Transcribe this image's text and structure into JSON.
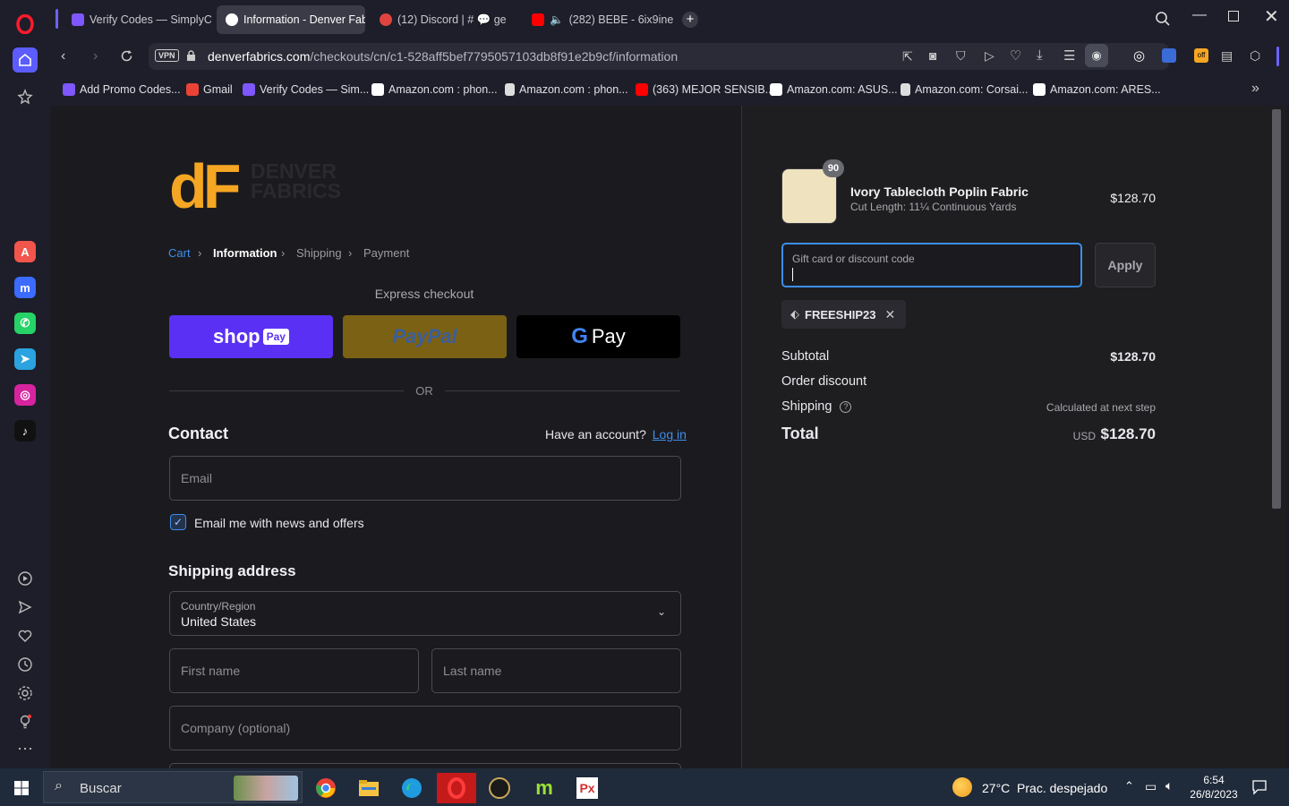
{
  "browser": {
    "tabs": [
      {
        "label": "Verify Codes — SimplyCo",
        "active": false
      },
      {
        "label": "Information - Denver Fabr",
        "active": true
      },
      {
        "label": "(12) Discord | # 💬 ge",
        "active": false
      },
      {
        "label": "(282) BEBE - 6ix9ine F",
        "active": false
      }
    ],
    "url_host": "denverfabrics.com",
    "url_path": "/checkouts/cn/c1-528aff5bef7795057103db8f91e2b9cf/information",
    "vpn_label": "VPN",
    "bookmarks": [
      "Add Promo Codes...",
      "Gmail",
      "Verify Codes — Sim...",
      "Amazon.com : phon...",
      "Amazon.com : phon...",
      "(363) MEJOR SENSIB...",
      "Amazon.com: ASUS...",
      "Amazon.com: Corsai...",
      "Amazon.com: ARES..."
    ]
  },
  "checkout": {
    "logo_text": "dF",
    "logo_brand_1": "DENVER",
    "logo_brand_2": "FABRICS",
    "breadcrumb": {
      "cart": "Cart",
      "information": "Information",
      "shipping": "Shipping",
      "payment": "Payment"
    },
    "express_checkout": "Express checkout",
    "shop_pay": {
      "main": "shop",
      "badge": "Pay"
    },
    "paypal": "PayPal",
    "gpay": "Pay",
    "or": "OR",
    "contact_title": "Contact",
    "have_account": "Have an account?",
    "login": "Log in",
    "email_placeholder": "Email",
    "news_label": "Email me with news and offers",
    "shipping_title": "Shipping address",
    "country_label": "Country/Region",
    "country_value": "United States",
    "first_name_placeholder": "First name",
    "last_name_placeholder": "Last name",
    "company_placeholder": "Company (optional)"
  },
  "summary": {
    "item": {
      "qty": "90",
      "title": "Ivory Tablecloth Poplin Fabric",
      "variant": "Cut Length: 11¼ Continuous Yards",
      "price": "$128.70"
    },
    "discount_placeholder": "Gift card or discount code",
    "apply": "Apply",
    "code": "FREESHIP23",
    "subtotal_label": "Subtotal",
    "subtotal_value": "$128.70",
    "order_discount_label": "Order discount",
    "shipping_label": "Shipping",
    "shipping_value": "Calculated at next step",
    "total_label": "Total",
    "currency": "USD",
    "total_value": "$128.70"
  },
  "taskbar": {
    "search": "Buscar",
    "weather": "27°C  Prac. despejado",
    "time": "6:54",
    "date": "26/8/2023"
  },
  "colors": {
    "shop_pay": "#5a31f4",
    "paypal": "#ffc439",
    "accent_blue": "#3d8eea",
    "logo_orange": "#f5a623"
  }
}
